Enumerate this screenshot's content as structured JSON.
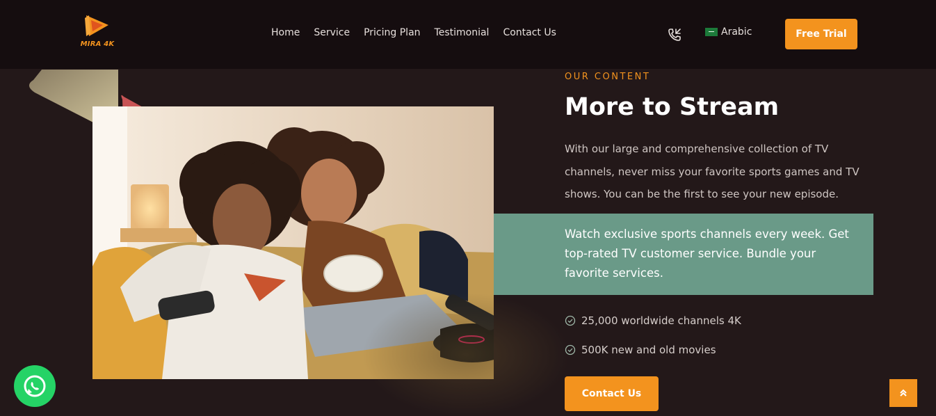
{
  "header": {
    "logo_text": "MIRA 4K",
    "nav": [
      {
        "label": "Home"
      },
      {
        "label": "Service"
      },
      {
        "label": "Pricing Plan"
      },
      {
        "label": "Testimonial"
      },
      {
        "label": "Contact Us"
      }
    ],
    "language_label": "Arabic",
    "trial_button": "Free Trial",
    "icons": {
      "phone": "phone-call-icon",
      "flag": "saudi-flag-icon"
    }
  },
  "content": {
    "eyebrow": "OUR CONTENT",
    "title": "More to Stream",
    "description": "With our large and comprehensive collection of TV channels, never miss your favorite sports games and TV shows. You can be the first to see your new episode.",
    "highlight": "Watch exclusive sports channels every week. Get top-rated TV customer service. Bundle your favorite services.",
    "features": [
      {
        "label": "25,000 worldwide channels 4K",
        "icon": "check-circle-icon"
      },
      {
        "label": "500K new and old movies",
        "icon": "check-circle-icon"
      }
    ],
    "contact_button": "Contact Us"
  },
  "floating": {
    "whatsapp_icon": "whatsapp-icon",
    "scroll_top_icon": "double-chevron-up-icon"
  },
  "colors": {
    "accent": "#f3931e",
    "background": "#231819",
    "header_bg": "#150d0f",
    "highlight_bg": "#6a9a88",
    "whatsapp": "#25d366"
  }
}
